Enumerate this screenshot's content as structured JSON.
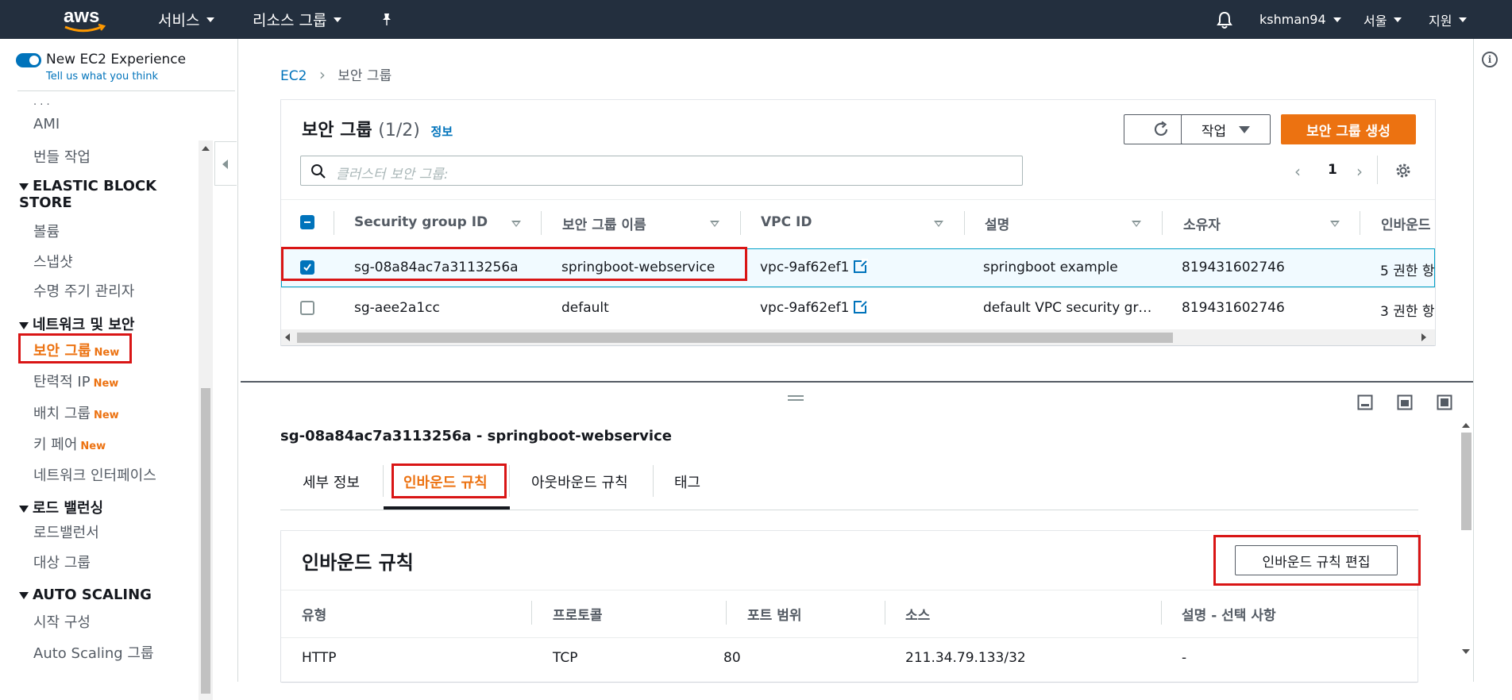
{
  "topnav": {
    "logo": "aws",
    "services": "서비스",
    "resource_groups": "리소스 그룹",
    "user": "kshman94",
    "region": "서울",
    "support": "지원"
  },
  "sidebar": {
    "toggle_label": "New EC2 Experience",
    "toggle_sub": "Tell us what you think",
    "partial_item": "·  ·  ·",
    "ami": "AMI",
    "bundle": "번들 작업",
    "ebs_head": "ELASTIC BLOCK STORE",
    "volumes": "볼륨",
    "snapshots": "스냅샷",
    "lifecycle": "수명 주기 관리자",
    "net_head": "네트워크 및 보안",
    "security_groups": "보안 그룹",
    "elastic_ip": "탄력적 IP",
    "placement": "배치 그룹",
    "key_pairs": "키 페어",
    "net_interfaces": "네트워크 인터페이스",
    "lb_head": "로드 밸런싱",
    "load_balancers": "로드밸런서",
    "target_groups": "대상 그룹",
    "as_head": "AUTO SCALING",
    "launch_config": "시작 구성",
    "as_groups": "Auto Scaling 그룹",
    "new_tag": "New"
  },
  "breadcrumb": {
    "root": "EC2",
    "current": "보안 그룹"
  },
  "sg_panel": {
    "title": "보안 그룹",
    "count": "(1/2)",
    "info": "정보",
    "actions": "작업",
    "create": "보안 그룹 생성",
    "search_placeholder": "클러스터 보안 그룹:",
    "page": "1",
    "columns": [
      "Security group ID",
      "보안 그룹 이름",
      "VPC ID",
      "설명",
      "소유자",
      "인바운드"
    ],
    "rows": [
      {
        "id": "sg-08a84ac7a3113256a",
        "name": "springboot-webservice",
        "vpc": "vpc-9af62ef1",
        "desc": "springboot example",
        "owner": "819431602746",
        "inbound": "5 권한 항"
      },
      {
        "id": "sg-aee2a1cc",
        "name": "default",
        "vpc": "vpc-9af62ef1",
        "desc": "default VPC security gr…",
        "owner": "819431602746",
        "inbound": "3 권한 항"
      }
    ]
  },
  "detail": {
    "title": "sg-08a84ac7a3113256a - springboot-webservice",
    "tabs": [
      "세부 정보",
      "인바운드 규칙",
      "아웃바운드 규칙",
      "태그"
    ],
    "inbound_title": "인바운드 규칙",
    "edit_button": "인바운드 규칙 편집",
    "columns": [
      "유형",
      "프로토콜",
      "포트 범위",
      "소스",
      "설명 - 선택 사항"
    ],
    "row": {
      "type": "HTTP",
      "protocol": "TCP",
      "port": "80",
      "source": "211.34.79.133/32",
      "desc": "-"
    }
  },
  "colors": {
    "nav_bg": "#232f3e",
    "accent": "#ec7211",
    "link": "#0073bb",
    "highlight": "#d91515"
  }
}
